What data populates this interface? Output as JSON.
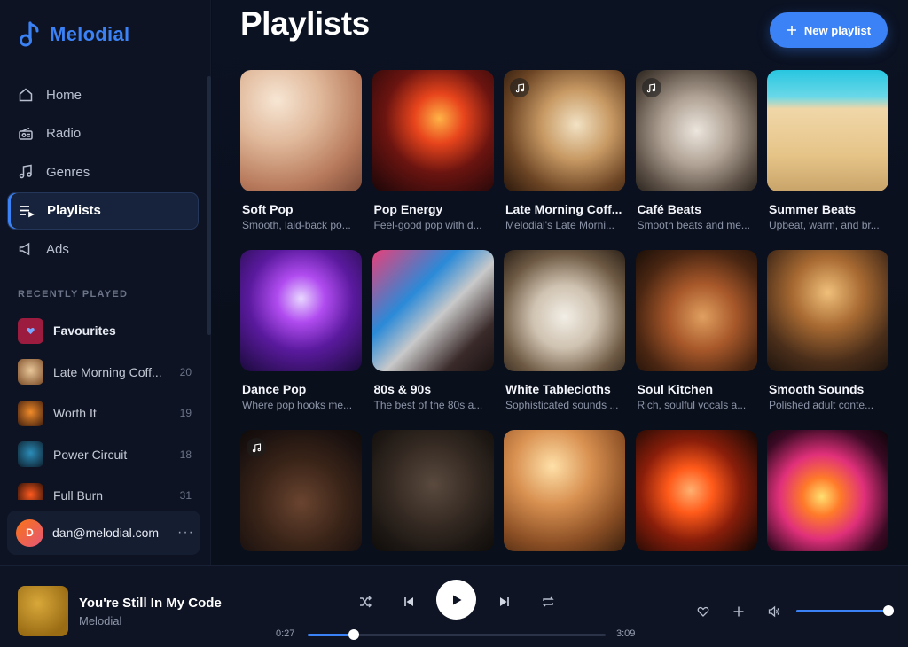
{
  "app": {
    "name": "Melodial",
    "accent": "#3b82f6"
  },
  "nav": [
    {
      "label": "Home",
      "icon": "home-icon",
      "active": false
    },
    {
      "label": "Radio",
      "icon": "radio-icon",
      "active": false
    },
    {
      "label": "Genres",
      "icon": "music-note-icon",
      "active": false
    },
    {
      "label": "Playlists",
      "icon": "playlist-icon",
      "active": true
    },
    {
      "label": "Ads",
      "icon": "megaphone-icon",
      "active": false
    }
  ],
  "recently_played": {
    "label": "RECENTLY PLAYED",
    "items": [
      {
        "name": "Favourites",
        "count": "",
        "colors": [
          "#c0254d",
          "#6d1635"
        ]
      },
      {
        "name": "Late Morning Coff...",
        "count": "20",
        "colors": [
          "#e9c79a",
          "#7a4a25"
        ]
      },
      {
        "name": "Worth It",
        "count": "19",
        "colors": [
          "#f08b2a",
          "#3a1a0d"
        ]
      },
      {
        "name": "Power Circuit",
        "count": "18",
        "colors": [
          "#2b8cb8",
          "#0d1d2a"
        ]
      },
      {
        "name": "Full Burn",
        "count": "31",
        "colors": [
          "#ff5a1f",
          "#1a0a05"
        ]
      }
    ]
  },
  "user": {
    "initial": "D",
    "email": "dan@melodial.com"
  },
  "page": {
    "title": "Playlists",
    "new_button": "New playlist"
  },
  "playlists": [
    {
      "title": "Soft Pop",
      "desc": "Smooth, laid-back po...",
      "note": false,
      "bg": "radial-gradient(circle at 30% 25%, #f7e6d4 0%, #e0b89a 35%, #b87a5c 70%, #7a4a38 100%)"
    },
    {
      "title": "Pop Energy",
      "desc": "Feel-good pop with d...",
      "note": false,
      "bg": "radial-gradient(circle at 55% 40%, #ffb347 0%, #e8451c 25%, #6b1410 55%, #1a0608 100%)"
    },
    {
      "title": "Late Morning Coff...",
      "desc": "Melodial's Late Morni...",
      "note": true,
      "bg": "radial-gradient(circle at 60% 45%, #f2e2c4 0%, #c89a64 35%, #6b4424 70%, #2a180c 100%)"
    },
    {
      "title": "Café Beats",
      "desc": "Smooth beats and me...",
      "note": true,
      "bg": "radial-gradient(circle at 50% 50%, #ece6de 0%, #b0a294 40%, #5e5248 75%, #2a241e 100%)"
    },
    {
      "title": "Summer Beats",
      "desc": "Upbeat, warm, and br...",
      "note": false,
      "bg": "linear-gradient(180deg, #28c6e0 0%, #6ad8e8 22%, #f0d7a8 32%, #e6c488 70%, #c9a46a 100%)"
    },
    {
      "title": "Dance Pop",
      "desc": "Where pop hooks me...",
      "note": false,
      "bg": "radial-gradient(circle at 50% 40%, #e8d8ff 0%, #b14cf0 25%, #5a1a9e 55%, #1a0a3a 100%)"
    },
    {
      "title": "80s & 90s",
      "desc": "The best of the 80s a...",
      "note": false,
      "bg": "linear-gradient(135deg, #e8407a 0%, #2a8ad8 35%, #c9c9c9 55%, #3a2a2a 80%, #1a1212 100%)"
    },
    {
      "title": "White Tablecloths",
      "desc": "Sophisticated sounds ...",
      "note": false,
      "bg": "radial-gradient(circle at 50% 55%, #f2eee6 0%, #cfc2b0 35%, #6e5a44 70%, #2a2018 100%)"
    },
    {
      "title": "Soul Kitchen",
      "desc": "Rich, soulful vocals a...",
      "note": false,
      "bg": "radial-gradient(circle at 55% 55%, #e0a060 0%, #a8582a 35%, #4a2612 70%, #1a0e08 100%)"
    },
    {
      "title": "Smooth Sounds",
      "desc": "Polished adult conte...",
      "note": false,
      "bg": "radial-gradient(circle at 50% 35%, #f0c07a 0%, #a86a32 35%, #4a2e1a 70%, #1e140e 100%)"
    },
    {
      "title": "Funk - Instrument...",
      "desc": "",
      "note": true,
      "bg": "radial-gradient(circle at 50% 60%, #6a4430 0%, #3a2418 45%, #1c1210 80%, #0e0a08 100%)"
    },
    {
      "title": "Beast Mode",
      "desc": "",
      "note": false,
      "bg": "radial-gradient(circle at 50% 45%, #5a4a3e 0%, #3a2e26 40%, #1e1814 75%, #0e0c0a 100%)"
    },
    {
      "title": "Golden Hour Opti...",
      "desc": "",
      "note": false,
      "bg": "radial-gradient(circle at 40% 30%, #ffe0a8 0%, #d89050 35%, #8a4e24 70%, #3a200e 100%)"
    },
    {
      "title": "Full Burn",
      "desc": "",
      "note": false,
      "bg": "radial-gradient(circle at 45% 50%, #ffb070 0%, #ff5a1a 25%, #8a1e0a 55%, #0e0604 100%)"
    },
    {
      "title": "Double Shot",
      "desc": "",
      "note": false,
      "bg": "radial-gradient(circle at 45% 55%, #ffe070 0%, #ff7a2a 20%, #e0307a 45%, #3a0a24 75%, #0a0408 100%)"
    }
  ],
  "player": {
    "title": "You're Still In My Code",
    "artist": "Melodial",
    "elapsed": "0:27",
    "duration": "3:09",
    "progress": 0.155,
    "volume": 0.98
  }
}
